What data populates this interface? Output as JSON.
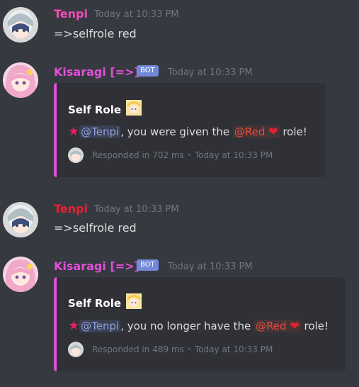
{
  "messages": [
    {
      "author": "Tenpi",
      "author_color": "#f04cb6",
      "timestamp": "Today at 10:33 PM",
      "content": "=>selfrole red"
    },
    {
      "author": "Kisaragi [=>]",
      "author_color": "#e34fdb",
      "badge": "BOT",
      "timestamp": "Today at 10:33 PM",
      "embed": {
        "title": "Self Role",
        "mention_user": "@Tenpi",
        "text_before_role": ", you were given the",
        "mention_role": "@Red",
        "text_after_role": "role!",
        "footer_text": "Responded in 702 ms",
        "footer_time": "Today at 10:33 PM"
      }
    },
    {
      "author": "Tenpi",
      "author_color": "#e8212f",
      "timestamp": "Today at 10:33 PM",
      "content": "=>selfrole red"
    },
    {
      "author": "Kisaragi [=>]",
      "author_color": "#e34fdb",
      "badge": "BOT",
      "timestamp": "Today at 10:33 PM",
      "embed": {
        "title": "Self Role",
        "mention_user": "@Tenpi",
        "text_before_role": ", you no longer have the",
        "mention_role": "@Red",
        "text_after_role": "role!",
        "footer_text": "Responded in 489 ms",
        "footer_time": "Today at 10:33 PM"
      }
    }
  ],
  "icons": {
    "star": "star-icon",
    "heart": "heart-icon",
    "thumbnail": "anime-girl-emoji-icon"
  },
  "colors": {
    "background": "#36393f",
    "embed_background": "#2f3136",
    "embed_border": "#e34fdb",
    "bot_badge": "#7289da"
  }
}
